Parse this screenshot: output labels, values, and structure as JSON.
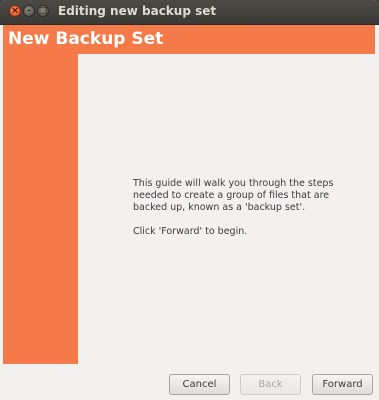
{
  "window": {
    "title": "Editing new backup set",
    "close_glyph": "×",
    "minimize_glyph": "–",
    "maximize_glyph": "□"
  },
  "banner": {
    "title": "New Backup Set",
    "color": "#f47b49"
  },
  "intro": {
    "paragraph1": "This guide will walk you through the steps needed to create a group of files that are backed up, known as a 'backup set'.",
    "paragraph2": "Click 'Forward' to begin."
  },
  "buttons": {
    "cancel": "Cancel",
    "back": "Back",
    "forward": "Forward"
  }
}
